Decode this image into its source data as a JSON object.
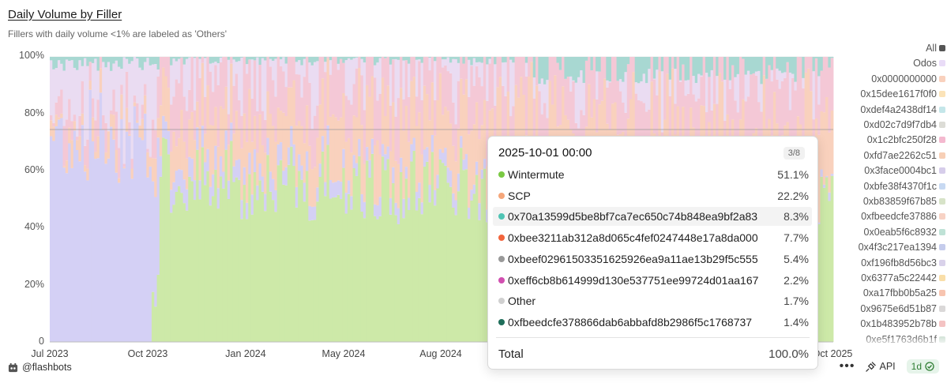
{
  "header": {
    "title": "Daily Volume by Filler",
    "subtitle": "Fillers with daily volume <1% are labeled as 'Others'"
  },
  "chart_data": {
    "type": "area",
    "stacked": true,
    "normalized": true,
    "title": "Daily Volume by Filler",
    "subtitle": "Fillers with daily volume <1% are labeled as 'Others'",
    "xlabel": "",
    "ylabel": "",
    "ylim": [
      0,
      100
    ],
    "y_tick_labels": [
      "100%",
      "80%",
      "60%",
      "40%",
      "20%",
      "0"
    ],
    "y_ticks": [
      100,
      80,
      60,
      40,
      20,
      0
    ],
    "x_tick_labels": [
      "Jul 2023",
      "Oct 2023",
      "Jan 2024",
      "May 2024",
      "Aug 2024",
      "Oct 2025"
    ],
    "x_ticks": [
      "2023-07-01",
      "2023-10-01",
      "2024-01-01",
      "2024-05-01",
      "2024-08-01",
      "2025-10-01"
    ],
    "x_range": [
      "2023-07-01",
      "2025-10-16"
    ],
    "grid": true,
    "legend_position": "right",
    "legend": [
      {
        "name": "All",
        "color": "#555555"
      },
      {
        "name": "Odos",
        "color": "#e9dcf7"
      },
      {
        "name": "0x0000000000",
        "color": "#f9d1bd"
      },
      {
        "name": "0x15dee1617f0f0",
        "color": "#fbe3b8"
      },
      {
        "name": "0xdef4a2438df14",
        "color": "#c4e6e9"
      },
      {
        "name": "0xd02c7d9f7db4",
        "color": "#dcdcd6"
      },
      {
        "name": "0x1c2bfc250f28",
        "color": "#f4b9cf"
      },
      {
        "name": "0xfd7ae2262c51",
        "color": "#f7cfb6"
      },
      {
        "name": "0x3face0004bc1",
        "color": "#d6cdea"
      },
      {
        "name": "0xbfe38f4370f1c",
        "color": "#c7d9f2"
      },
      {
        "name": "0xb83859f67b85",
        "color": "#d7e3c8"
      },
      {
        "name": "0xfbeedcfe37886",
        "color": "#f7d2c4"
      },
      {
        "name": "0x0eab5f6c8932",
        "color": "#bfe2d6"
      },
      {
        "name": "0x4f3c217ea1394",
        "color": "#c5ccec"
      },
      {
        "name": "0xf196fb8d56bc3",
        "color": "#d9d2ea"
      },
      {
        "name": "0x6377a5c22442",
        "color": "#f9dea8"
      },
      {
        "name": "0xa17fbb0b5a25",
        "color": "#f7c4b0"
      },
      {
        "name": "0x9675e6d51b87",
        "color": "#dad8d8"
      },
      {
        "name": "0x1b483952b78b",
        "color": "#f4c3c3"
      },
      {
        "name": "0xe5f1763d6b1f",
        "color": "#cfe0d4"
      }
    ],
    "series_colors": {
      "wintermute": "#cde9a8",
      "scp": "#f9d1bd",
      "odos": "#d4d0f5",
      "pink": "#f4c8d6",
      "teal": "#a8d8d2"
    },
    "tooltip": {
      "date": "2025-10-01 00:00",
      "page": "3/8",
      "rows": [
        {
          "name": "Wintermute",
          "value": "51.1%",
          "color": "#7ac943"
        },
        {
          "name": "SCP",
          "value": "22.2%",
          "color": "#f5a67a"
        },
        {
          "name": "0x70a13599d5be8bf7ca7ec650c74b848ea9bf2a83",
          "value": "8.3%",
          "color": "#4fc4b4"
        },
        {
          "name": "0xbee3211ab312a8d065c4fef0247448e17a8da000",
          "value": "7.7%",
          "color": "#f2643c"
        },
        {
          "name": "0xbeef02961503351625926ea9a11ae13b29f5c555",
          "value": "5.4%",
          "color": "#999999"
        },
        {
          "name": "0xeff6cb8b614999d130e537751ee99724d01aa167",
          "value": "2.2%",
          "color": "#d14fb0"
        },
        {
          "name": "Other",
          "value": "1.7%",
          "color": "#d0d0d0"
        },
        {
          "name": "0xfbeedcfe378866dab6abbafd8b2986f5c1768737",
          "value": "1.4%",
          "color": "#1f6e5a"
        }
      ],
      "highlighted_index": 2,
      "total_label": "Total",
      "total_value": "100.0%"
    }
  },
  "footer": {
    "brand": "@flashbots",
    "more": "•••",
    "api": "API",
    "badge": "1d"
  }
}
